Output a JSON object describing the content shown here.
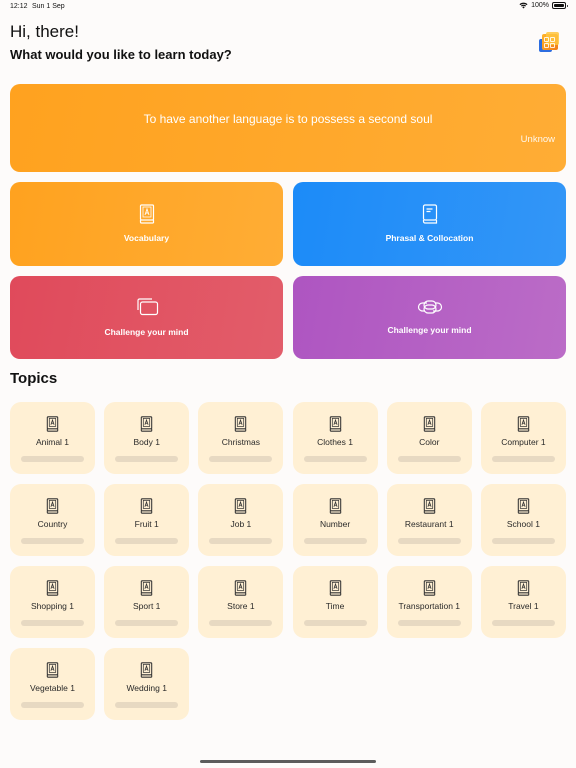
{
  "status_bar": {
    "time": "12:12",
    "date": "Sun 1 Sep",
    "battery": "100%",
    "icons": [
      "wifi-icon",
      "battery-icon"
    ]
  },
  "header": {
    "title": "Hi, there!",
    "subtitle": "What would you like to learn today?",
    "logo_icon": "app-logo"
  },
  "quote": {
    "text": "To have another language is to possess a second soul",
    "author": "Unknow",
    "color": "#ffa625"
  },
  "features": [
    {
      "label": "Vocabulary",
      "icon": "book-letter-icon",
      "color": "#ffa625"
    },
    {
      "label": "Phrasal & Collocation",
      "icon": "book-lines-icon",
      "color": "#2690f8"
    },
    {
      "label": "Challenge your mind",
      "icon": "cards-icon",
      "color": "#e05263"
    },
    {
      "label": "Challenge your mind",
      "icon": "link-icon",
      "color": "#b460c4"
    }
  ],
  "topics": {
    "heading": "Topics",
    "tile_color": "#fff0d4",
    "items": [
      {
        "name": "Animal 1",
        "progress": 0
      },
      {
        "name": "Body 1",
        "progress": 0
      },
      {
        "name": "Christmas",
        "progress": 0
      },
      {
        "name": "Clothes 1",
        "progress": 0
      },
      {
        "name": "Color",
        "progress": 0
      },
      {
        "name": "Computer 1",
        "progress": 0
      },
      {
        "name": "Country",
        "progress": 0
      },
      {
        "name": "Fruit 1",
        "progress": 0
      },
      {
        "name": "Job 1",
        "progress": 0
      },
      {
        "name": "Number",
        "progress": 0
      },
      {
        "name": "Restaurant 1",
        "progress": 0
      },
      {
        "name": "School 1",
        "progress": 0
      },
      {
        "name": "Shopping 1",
        "progress": 0
      },
      {
        "name": "Sport 1",
        "progress": 0
      },
      {
        "name": "Store 1",
        "progress": 0
      },
      {
        "name": "Time",
        "progress": 0
      },
      {
        "name": "Transportation 1",
        "progress": 0
      },
      {
        "name": "Travel 1",
        "progress": 0
      },
      {
        "name": "Vegetable 1",
        "progress": 0
      },
      {
        "name": "Wedding 1",
        "progress": 0
      }
    ]
  }
}
